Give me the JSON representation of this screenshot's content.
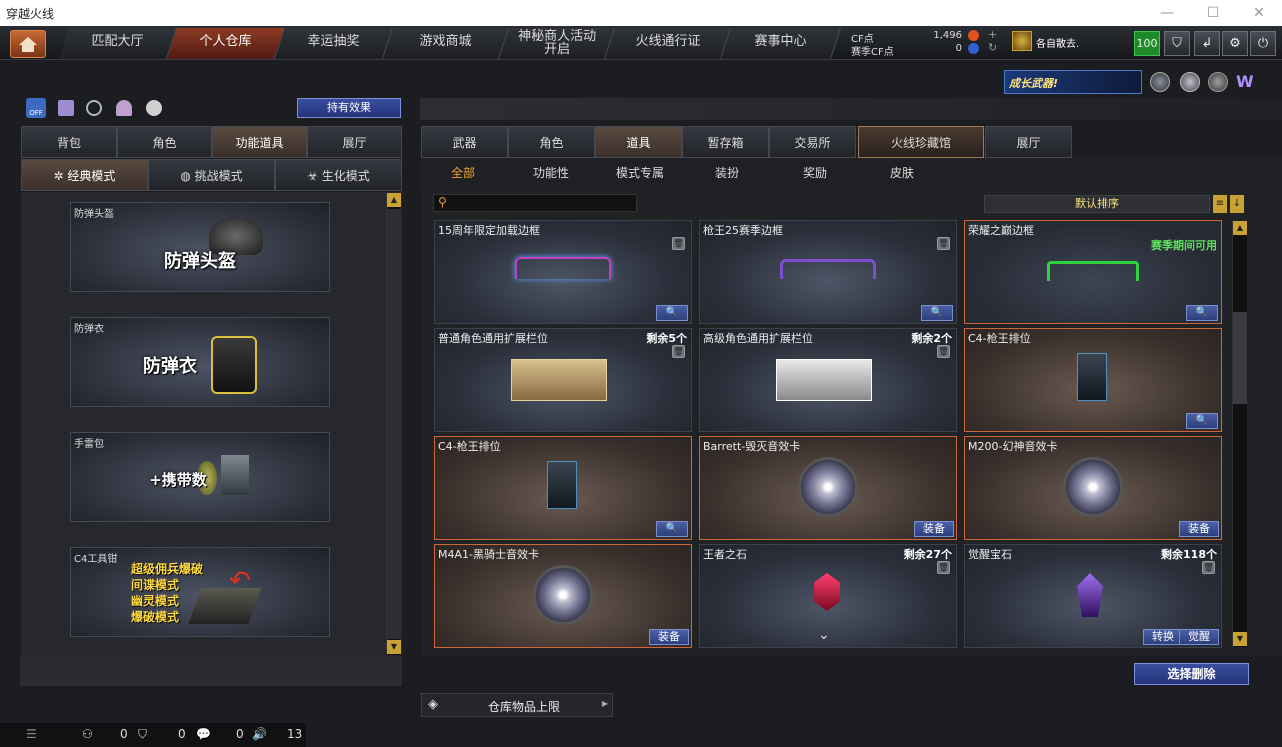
{
  "window": {
    "title": "穿越火线",
    "min": "—",
    "max": "☐",
    "close": "✕"
  },
  "nav": {
    "tabs": [
      {
        "label": "匹配大厅"
      },
      {
        "label": "个人仓库"
      },
      {
        "label": "幸运抽奖"
      },
      {
        "label": "游戏商城"
      },
      {
        "label": "神秘商人活动开启"
      },
      {
        "label": "火线通行证"
      },
      {
        "label": "赛事中心"
      }
    ]
  },
  "currency": {
    "cf_label": "CF点",
    "cf_value": "1,496",
    "gift_label": "赛季CF点",
    "gift_value": "0"
  },
  "user": {
    "name": "各自散去.",
    "level": "100"
  },
  "banner": {
    "text": "成长武器!"
  },
  "left": {
    "effect_button": "持有效果",
    "toggle_label": "OFF",
    "tabs": [
      {
        "label": "背包"
      },
      {
        "label": "角色"
      },
      {
        "label": "功能道具"
      },
      {
        "label": "展厅"
      }
    ],
    "modes": [
      {
        "label": "经典模式"
      },
      {
        "label": "挑战模式"
      },
      {
        "label": "生化模式"
      }
    ],
    "cards": [
      {
        "category": "防弹头盔",
        "title": "防弹头盔"
      },
      {
        "category": "防弹衣",
        "title": "防弹衣"
      },
      {
        "category": "手雷包",
        "title": "+携带数"
      },
      {
        "category": "C4工具钳",
        "lines": [
          "超级佣兵爆破",
          "间谍模式",
          "幽灵模式",
          "爆破模式"
        ]
      }
    ]
  },
  "right": {
    "tabs": [
      {
        "label": "武器"
      },
      {
        "label": "角色"
      },
      {
        "label": "道具"
      },
      {
        "label": "暂存箱"
      },
      {
        "label": "交易所"
      },
      {
        "label": "火线珍藏馆"
      },
      {
        "label": "展厅"
      }
    ],
    "subtabs": [
      {
        "label": "全部"
      },
      {
        "label": "功能性"
      },
      {
        "label": "模式专属"
      },
      {
        "label": "装扮"
      },
      {
        "label": "奖励"
      },
      {
        "label": "皮肤"
      }
    ],
    "search_placeholder": "",
    "sort_label": "默认排序",
    "items": [
      {
        "name": "15周年限定加载边框",
        "remain": "",
        "note": ""
      },
      {
        "name": "枪王25赛季边框",
        "remain": "",
        "note": ""
      },
      {
        "name": "荣耀之巅边框",
        "remain": "",
        "note": "赛季期间可用"
      },
      {
        "name": "普通角色通用扩展栏位",
        "remain": "剩余5个",
        "note": ""
      },
      {
        "name": "高级角色通用扩展栏位",
        "remain": "剩余2个",
        "note": ""
      },
      {
        "name": "C4-枪王排位",
        "remain": "",
        "note": ""
      },
      {
        "name": "C4-枪王排位",
        "remain": "",
        "note": ""
      },
      {
        "name": "Barrett-毁灭音效卡",
        "remain": "",
        "note": ""
      },
      {
        "name": "M200-幻神音效卡",
        "remain": "",
        "note": ""
      },
      {
        "name": "M4A1-黑骑士音效卡",
        "remain": "",
        "note": ""
      },
      {
        "name": "王者之石",
        "remain": "剩余27个",
        "note": ""
      },
      {
        "name": "觉醒宝石",
        "remain": "剩余118个",
        "note": ""
      }
    ],
    "equip_label": "装备",
    "convert_label": "转换",
    "awaken_label": "觉醒",
    "delete_button": "选择删除",
    "storage_label": "仓库物品上限"
  },
  "status": {
    "count1": "0",
    "count2": "0",
    "count3": "0",
    "count4": "13"
  }
}
